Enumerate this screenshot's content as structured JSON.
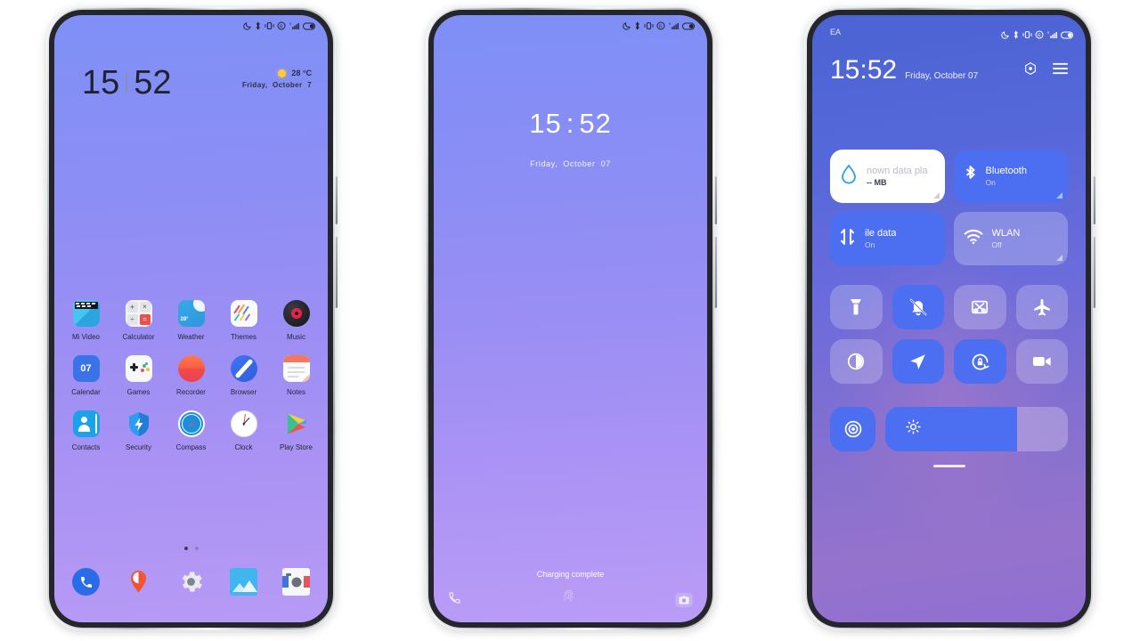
{
  "phone_home": {
    "status_bar": {
      "icons": [
        "dnd-moon-icon",
        "bluetooth-icon",
        "vibrate-icon",
        "roaming-icon",
        "signal-bars-icon",
        "battery-icon"
      ]
    },
    "clock": {
      "hours": "15",
      "minutes": "52"
    },
    "weather": {
      "temperature": "28 °C",
      "date": "Friday,  October   7",
      "condition_icon": "sun-icon"
    },
    "rows": [
      [
        {
          "label": "Mi Video",
          "icon": "mi-video-icon"
        },
        {
          "label": "Calculator",
          "icon": "calculator-icon"
        },
        {
          "label": "Weather",
          "icon": "weather-icon",
          "badge": "28°"
        },
        {
          "label": "Themes",
          "icon": "themes-icon"
        },
        {
          "label": "Music",
          "icon": "music-icon"
        }
      ],
      [
        {
          "label": "Calendar",
          "icon": "calendar-icon",
          "badge": "07"
        },
        {
          "label": "Games",
          "icon": "games-icon"
        },
        {
          "label": "Recorder",
          "icon": "recorder-icon"
        },
        {
          "label": "Browser",
          "icon": "browser-icon"
        },
        {
          "label": "Notes",
          "icon": "notes-icon"
        }
      ],
      [
        {
          "label": "Contacts",
          "icon": "contacts-icon"
        },
        {
          "label": "Security",
          "icon": "security-icon"
        },
        {
          "label": "Compass",
          "icon": "compass-icon"
        },
        {
          "label": "Clock",
          "icon": "clock-icon"
        },
        {
          "label": "Play Store",
          "icon": "play-store-icon"
        }
      ]
    ],
    "page_indicator": {
      "pages": 2,
      "active": 0
    },
    "dock": [
      {
        "label": "Phone",
        "icon": "phone-icon"
      },
      {
        "label": "Maps",
        "icon": "maps-icon"
      },
      {
        "label": "Settings",
        "icon": "settings-gear-icon"
      },
      {
        "label": "Gallery",
        "icon": "gallery-icon"
      },
      {
        "label": "Camera",
        "icon": "camera-icon"
      }
    ]
  },
  "phone_lock": {
    "status_bar": {
      "icons": [
        "dnd-moon-icon",
        "bluetooth-icon",
        "vibrate-icon",
        "roaming-icon",
        "signal-bars-icon",
        "battery-icon"
      ]
    },
    "clock": {
      "hours": "15",
      "separator": ":",
      "minutes": "52"
    },
    "date": "Friday, October   07",
    "charging_status": "Charging complete",
    "shortcuts": {
      "left": "phone-icon",
      "center": "fingerprint-icon",
      "right": "camera-icon"
    }
  },
  "phone_cc": {
    "carrier": "EA",
    "status_bar": {
      "icons": [
        "dnd-moon-icon",
        "bluetooth-icon",
        "vibrate-icon",
        "roaming-icon",
        "signal-bars-icon",
        "battery-icon"
      ]
    },
    "time": "15:52",
    "date": "Friday, October 07",
    "header_icons": [
      "settings-hex-icon",
      "menu-hamburger-icon"
    ],
    "big_tiles": [
      {
        "title": "nown data pla",
        "subtitle": "-- MB",
        "state": "white",
        "icon": "data-drop-icon"
      },
      {
        "title": "Bluetooth",
        "subtitle": "On",
        "state": "on",
        "icon": "bluetooth-icon"
      },
      {
        "title": "ile data",
        "subtitle": "On",
        "state": "on",
        "icon": "mobile-data-icon"
      },
      {
        "title": "WLAN",
        "subtitle": "Off",
        "state": "off",
        "icon": "wifi-icon"
      }
    ],
    "toggles": [
      {
        "name": "Flashlight",
        "icon": "flashlight-icon",
        "state": "off"
      },
      {
        "name": "Silent",
        "icon": "bell-mute-icon",
        "state": "on"
      },
      {
        "name": "Screenshot",
        "icon": "screenshot-icon",
        "state": "off"
      },
      {
        "name": "Airplane mode",
        "icon": "airplane-icon",
        "state": "off"
      },
      {
        "name": "Dark mode",
        "icon": "dark-mode-icon",
        "state": "off"
      },
      {
        "name": "Location",
        "icon": "location-arrow-icon",
        "state": "on"
      },
      {
        "name": "Auto-rotate",
        "icon": "rotation-lock-icon",
        "state": "on"
      },
      {
        "name": "Screen recorder",
        "icon": "video-camera-icon",
        "state": "off"
      }
    ],
    "brightness": {
      "icon": "brightness-sun-icon",
      "button_icon": "focus-ring-icon",
      "value": 72
    }
  },
  "colors": {
    "accent_blue": "#4c6ef0",
    "wall_home_top": "#7f90f6",
    "wall_home_bottom": "#b79af5",
    "wall_cc_top": "#4b63d4",
    "wall_cc_bottom": "#8f6fd2"
  }
}
